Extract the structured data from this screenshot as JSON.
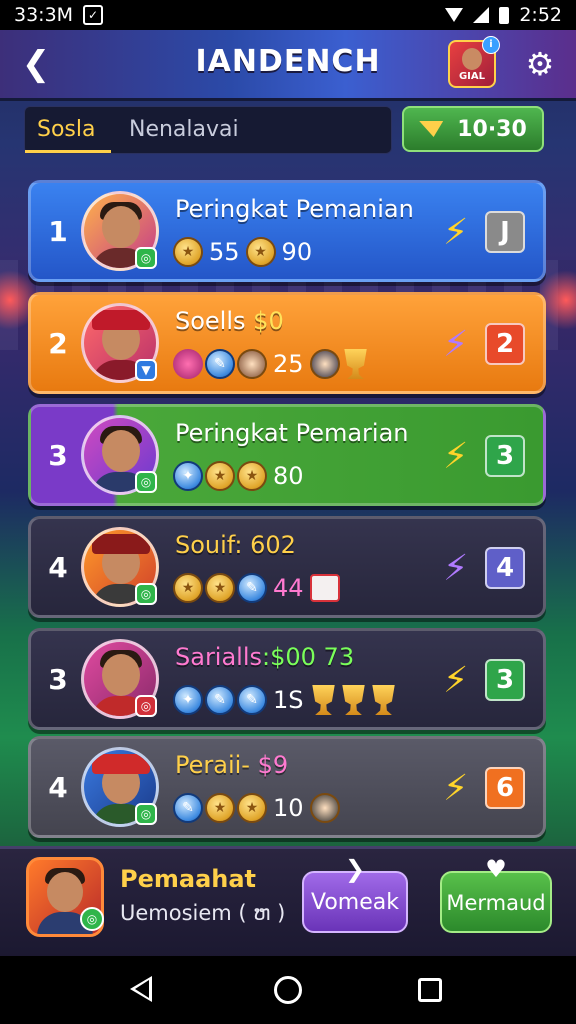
{
  "status_bar": {
    "time_left": "33:3M",
    "time_right": "2:52"
  },
  "header": {
    "title": "IANDENCH",
    "avatar_label": "GIAL"
  },
  "tabs": [
    {
      "label": "Sosla",
      "active": true
    },
    {
      "label": "Nenalavai",
      "active": false
    }
  ],
  "reward": {
    "label": "10·30"
  },
  "rows": [
    {
      "rank": "1",
      "name": "Peringkat Pemanian",
      "name_accent": "",
      "items_text": [
        "55",
        "90"
      ],
      "rank_box": "J",
      "color": "#2f6fe0",
      "box_color": "#8a8a8a"
    },
    {
      "rank": "2",
      "name": "Soells",
      "name_accent": "$0",
      "items_text": [
        "25"
      ],
      "rank_box": "2",
      "color": "#f28a1a",
      "box_color": "#e84a2a"
    },
    {
      "rank": "3",
      "name": "Peringkat Pemarian",
      "name_accent": "",
      "items_text": [
        "80"
      ],
      "rank_box": "3",
      "color": "#45a83a",
      "box_color": "#2fa54a"
    },
    {
      "rank": "4",
      "name": "Souif: 602",
      "name_accent": "",
      "items_text": [
        "44"
      ],
      "rank_box": "4",
      "color": "#2d2c46",
      "box_color": "#5f5fc8"
    },
    {
      "rank": "3",
      "name": "Sarialls",
      "name_accent": ":$00 73",
      "items_text": [
        "1S"
      ],
      "rank_box": "3",
      "color": "#2d2c46",
      "box_color": "#2fa54a"
    },
    {
      "rank": "4",
      "name": "Peraii-",
      "name_accent": "$9",
      "items_text": [
        "10"
      ],
      "rank_box": "6",
      "color": "#4b4b5a",
      "box_color": "#f07020"
    }
  ],
  "player": {
    "name": "Pemaahat",
    "subtitle": "Uemosiem ( ຫ )"
  },
  "buttons": {
    "purple_label": "Vomeak",
    "green_label": "Mermaud"
  }
}
